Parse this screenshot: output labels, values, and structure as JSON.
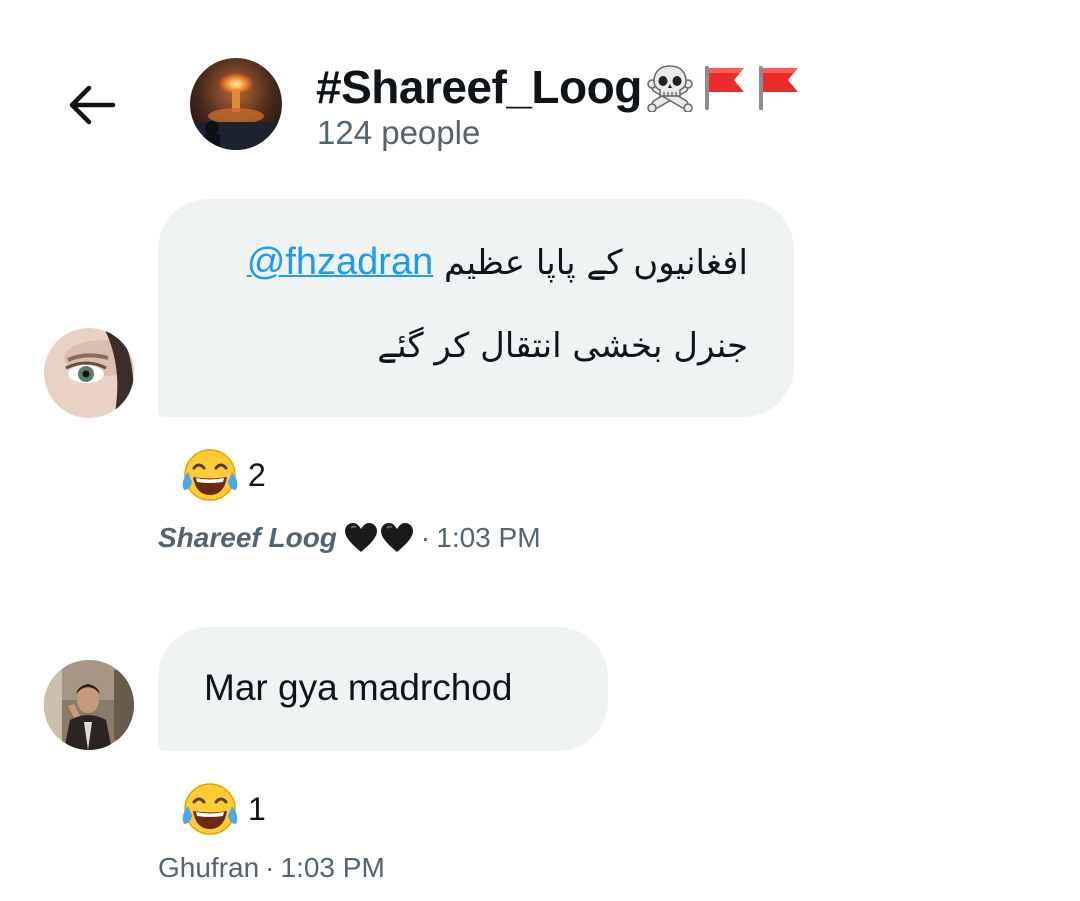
{
  "header": {
    "title": "#Shareef_Loog",
    "title_emojis": [
      "skull-crossbones-icon",
      "red-flag-icon",
      "red-flag-icon"
    ],
    "subtitle": "124 people"
  },
  "messages": [
    {
      "urdu_line1": "افغانیوں کے پاپا عظیم",
      "mention": "@fhzadran",
      "urdu_line2": "جنرل بخشی انتقال کر گئے",
      "reaction_emoji": "face-with-tears-of-joy-icon",
      "reaction_count": "2",
      "sender": "Shareef Loog",
      "sender_emojis": [
        "black-heart-icon",
        "black-heart-icon"
      ],
      "separator": "·",
      "time": "1:03 PM"
    },
    {
      "text": "Mar gya madrchod",
      "reaction_emoji": "face-with-tears-of-joy-icon",
      "reaction_count": "1",
      "sender": "Ghufran",
      "separator": "·",
      "time": "1:03 PM"
    }
  ],
  "colors": {
    "bubble": "#eff3f4",
    "link": "#1d9bf0",
    "secondary_text": "#536471",
    "primary_text": "#0f1419"
  }
}
